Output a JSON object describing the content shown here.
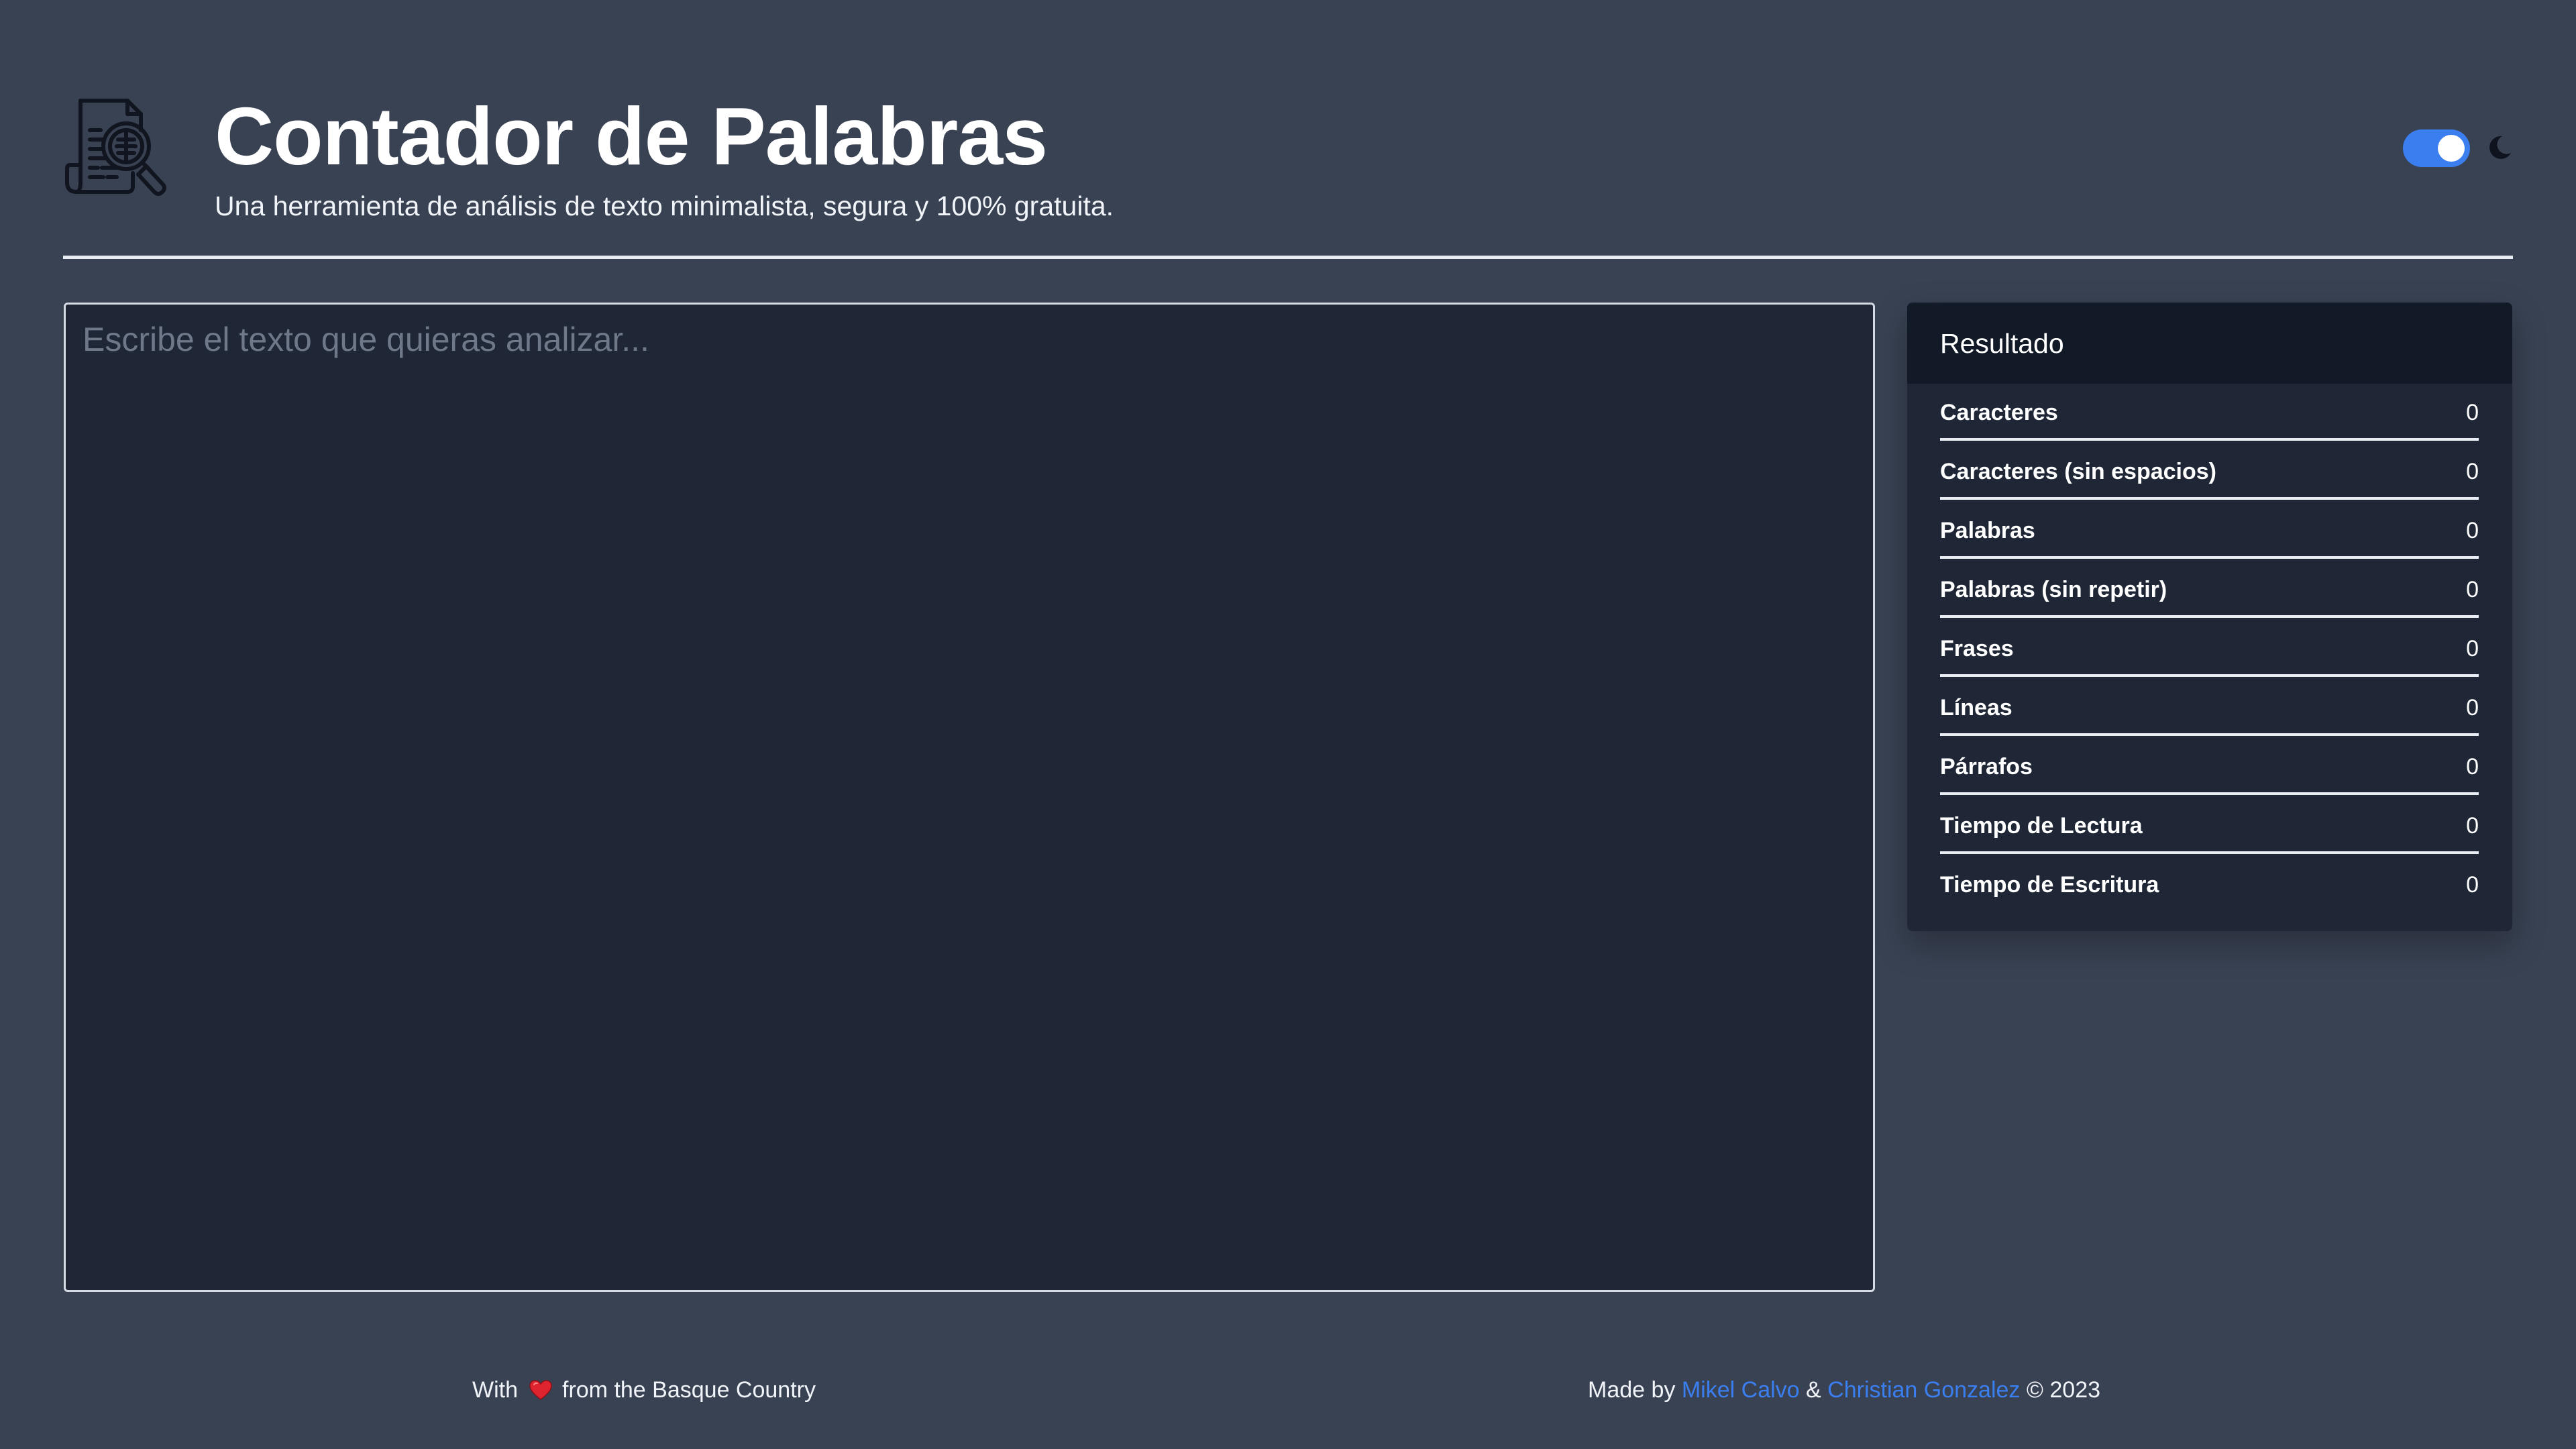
{
  "header": {
    "logo_icon": "document-search-icon",
    "title": "Contador de Palabras",
    "subtitle": "Una herramienta de análisis de texto minimalista, segura y 100% gratuita.",
    "theme_toggle": {
      "state": "on",
      "icon": "moon-icon",
      "accent_color": "#3b7ef0"
    }
  },
  "editor": {
    "placeholder": "Escribe el texto que quieras analizar...",
    "value": ""
  },
  "results": {
    "title": "Resultado",
    "rows": [
      {
        "label": "Caracteres",
        "value": "0"
      },
      {
        "label": "Caracteres (sin espacios)",
        "value": "0"
      },
      {
        "label": "Palabras",
        "value": "0"
      },
      {
        "label": "Palabras (sin repetir)",
        "value": "0"
      },
      {
        "label": "Frases",
        "value": "0"
      },
      {
        "label": "Líneas",
        "value": "0"
      },
      {
        "label": "Párrafos",
        "value": "0"
      },
      {
        "label": "Tiempo de Lectura",
        "value": "0"
      },
      {
        "label": "Tiempo de Escritura",
        "value": "0"
      }
    ]
  },
  "footer": {
    "left": {
      "prefix": "With",
      "icon": "heart-icon",
      "suffix": "from the Basque Country"
    },
    "right": {
      "prefix": "Made by",
      "author1": "Mikel Calvo",
      "separator": "&",
      "author2": "Christian Gonzalez",
      "copyright": "© 2023"
    }
  },
  "colors": {
    "background": "#394253",
    "surface": "#1f2737",
    "panel_header": "#121927",
    "accent": "#3b7ef0",
    "heart": "#e0242f"
  }
}
